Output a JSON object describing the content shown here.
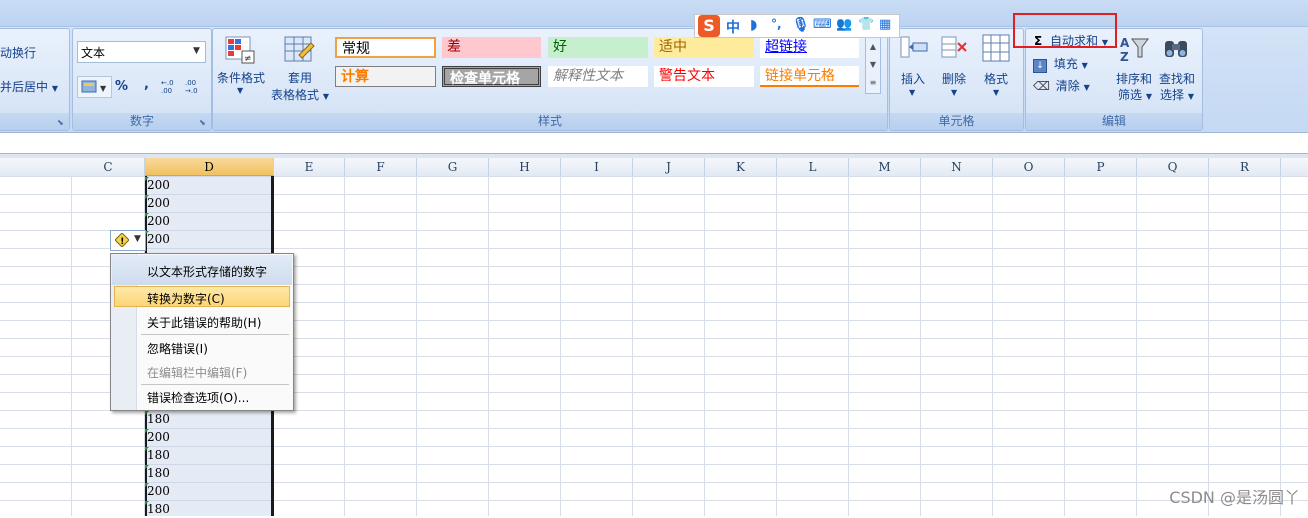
{
  "ribbon": {
    "alignment_group": {
      "wrap_text": "自动换行",
      "merge_center": "合并后居中"
    },
    "number_group": {
      "label": "数字",
      "format_value": "文本",
      "percent_symbol": "%",
      "comma_symbol": ",",
      "increase_decimal": "+.0 .00",
      "decrease_decimal": ".00 +.0"
    },
    "styles_group": {
      "label": "样式",
      "conditional_formatting": "条件格式",
      "format_as_table_line1": "套用",
      "format_as_table_line2": "表格格式",
      "cell_styles": [
        {
          "text": "常规",
          "bg": "#ffffff",
          "color": "#000000",
          "border": "#f0a040"
        },
        {
          "text": "差",
          "bg": "#ffc7ce",
          "color": "#9c0006"
        },
        {
          "text": "好",
          "bg": "#c6efce",
          "color": "#006100"
        },
        {
          "text": "适中",
          "bg": "#ffeb9c",
          "color": "#9c6500"
        },
        {
          "text": "超链接",
          "bg": "#ffffff",
          "color": "#0000ff"
        },
        {
          "text": "计算",
          "bg": "#f2f2f2",
          "color": "#fa7d00"
        },
        {
          "text": "检查单元格",
          "bg": "#a5a5a5",
          "color": "#ffffff"
        },
        {
          "text": "解释性文本",
          "bg": "#ffffff",
          "color": "#7f7f7f"
        },
        {
          "text": "警告文本",
          "bg": "#ffffff",
          "color": "#ff0000"
        },
        {
          "text": "链接单元格",
          "bg": "#ffffff",
          "color": "#fa7d00"
        }
      ]
    },
    "cells_group": {
      "label": "单元格",
      "insert": "插入",
      "delete": "删除",
      "format": "格式"
    },
    "editing_group": {
      "label": "编辑",
      "autosum": "自动求和",
      "fill": "填充",
      "clear": "清除",
      "sort_filter_line1": "排序和",
      "sort_filter_line2": "筛选",
      "find_select_line1": "查找和",
      "find_select_line2": "选择"
    }
  },
  "ime": {
    "logo": "S",
    "mode": "中"
  },
  "sheet": {
    "columns": [
      "C",
      "D",
      "E",
      "F",
      "G",
      "H",
      "I",
      "J",
      "K",
      "L",
      "M",
      "N",
      "O",
      "P",
      "Q",
      "R"
    ],
    "selected_column": "D",
    "d_values_top": [
      "200",
      "200",
      "200",
      "200"
    ],
    "d_values_bottom": [
      "180",
      "200",
      "180",
      "180",
      "200",
      "180"
    ]
  },
  "context_menu": {
    "header": "以文本形式存储的数字",
    "items": [
      {
        "label": "转换为数字(C)",
        "enabled": true,
        "highlighted": true
      },
      {
        "label": "关于此错误的帮助(H)",
        "enabled": true
      },
      {
        "label": "忽略错误(I)",
        "enabled": true
      },
      {
        "label": "在编辑栏中编辑(F)",
        "enabled": false
      },
      {
        "label": "错误检查选项(O)...",
        "enabled": true
      }
    ]
  },
  "watermark": "CSDN @是汤圆丫"
}
